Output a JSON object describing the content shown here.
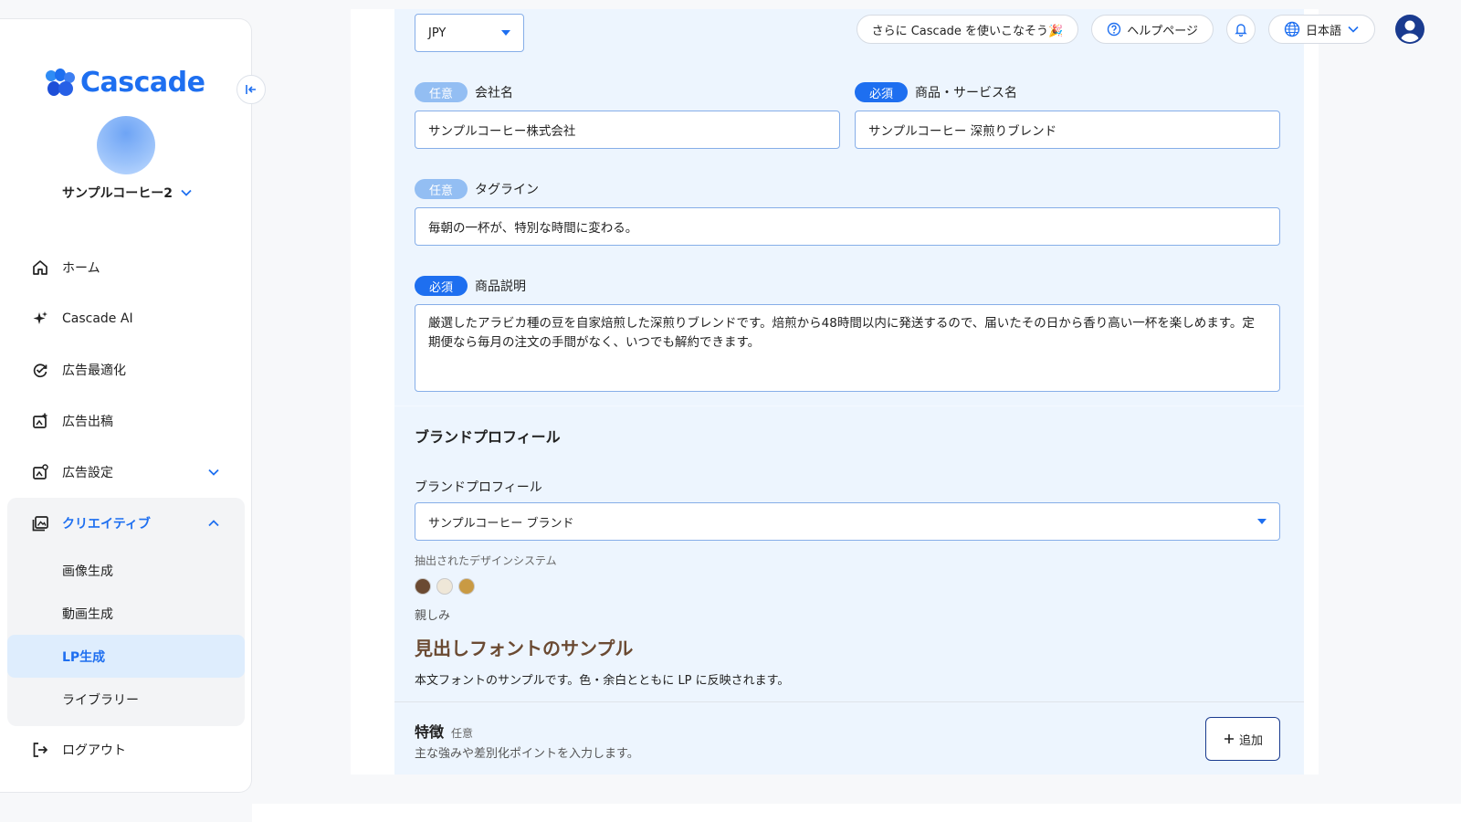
{
  "brand": {
    "name": "Cascade",
    "accent": "#1e6ff0"
  },
  "account": {
    "name": "サンプルコーヒー2"
  },
  "nav": {
    "home": "ホーム",
    "ai": "Cascade AI",
    "optimize": "広告最適化",
    "publish": "広告出稿",
    "settings": "広告設定",
    "creative": "クリエイティブ",
    "sub": {
      "image": "画像生成",
      "video": "動画生成",
      "lp": "LP生成",
      "library": "ライブラリー"
    },
    "logout": "ログアウト"
  },
  "topbar": {
    "promo": "さらに Cascade を使いこなそう🎉",
    "help": "ヘルプページ",
    "language": "日本語"
  },
  "form": {
    "currency": "JPY",
    "badge_optional": "任意",
    "badge_required": "必須",
    "company_label": "会社名",
    "company_value": "サンプルコーヒー株式会社",
    "product_label": "商品・サービス名",
    "product_value": "サンプルコーヒー 深煎りブレンド",
    "tagline_label": "タグライン",
    "tagline_value": "毎朝の一杯が、特別な時間に変わる。",
    "description_label": "商品説明",
    "description_value": "厳選したアラビカ種の豆を自家焙煎した深煎りブレンドです。焙煎から48時間以内に発送するので、届いたその日から香り高い一杯を楽しめます。定期便なら毎月の注文の手間がなく、いつでも解約できます。"
  },
  "brand_profile": {
    "section_title": "ブランドプロフィール",
    "field_label": "ブランドプロフィール",
    "selected": "サンプルコーヒー ブランド",
    "design_system_caption": "抽出されたデザインシステム",
    "colors": [
      "#6b4a32",
      "#efe7d8",
      "#c99a43"
    ],
    "tone": "親しみ",
    "heading_sample": "見出しフォントのサンプル",
    "body_sample": "本文フォントのサンプルです。色・余白とともに LP に反映されます。"
  },
  "features": {
    "title": "特徴",
    "optional": "任意",
    "description": "主な強みや差別化ポイントを入力します。",
    "add_label": "追加"
  }
}
